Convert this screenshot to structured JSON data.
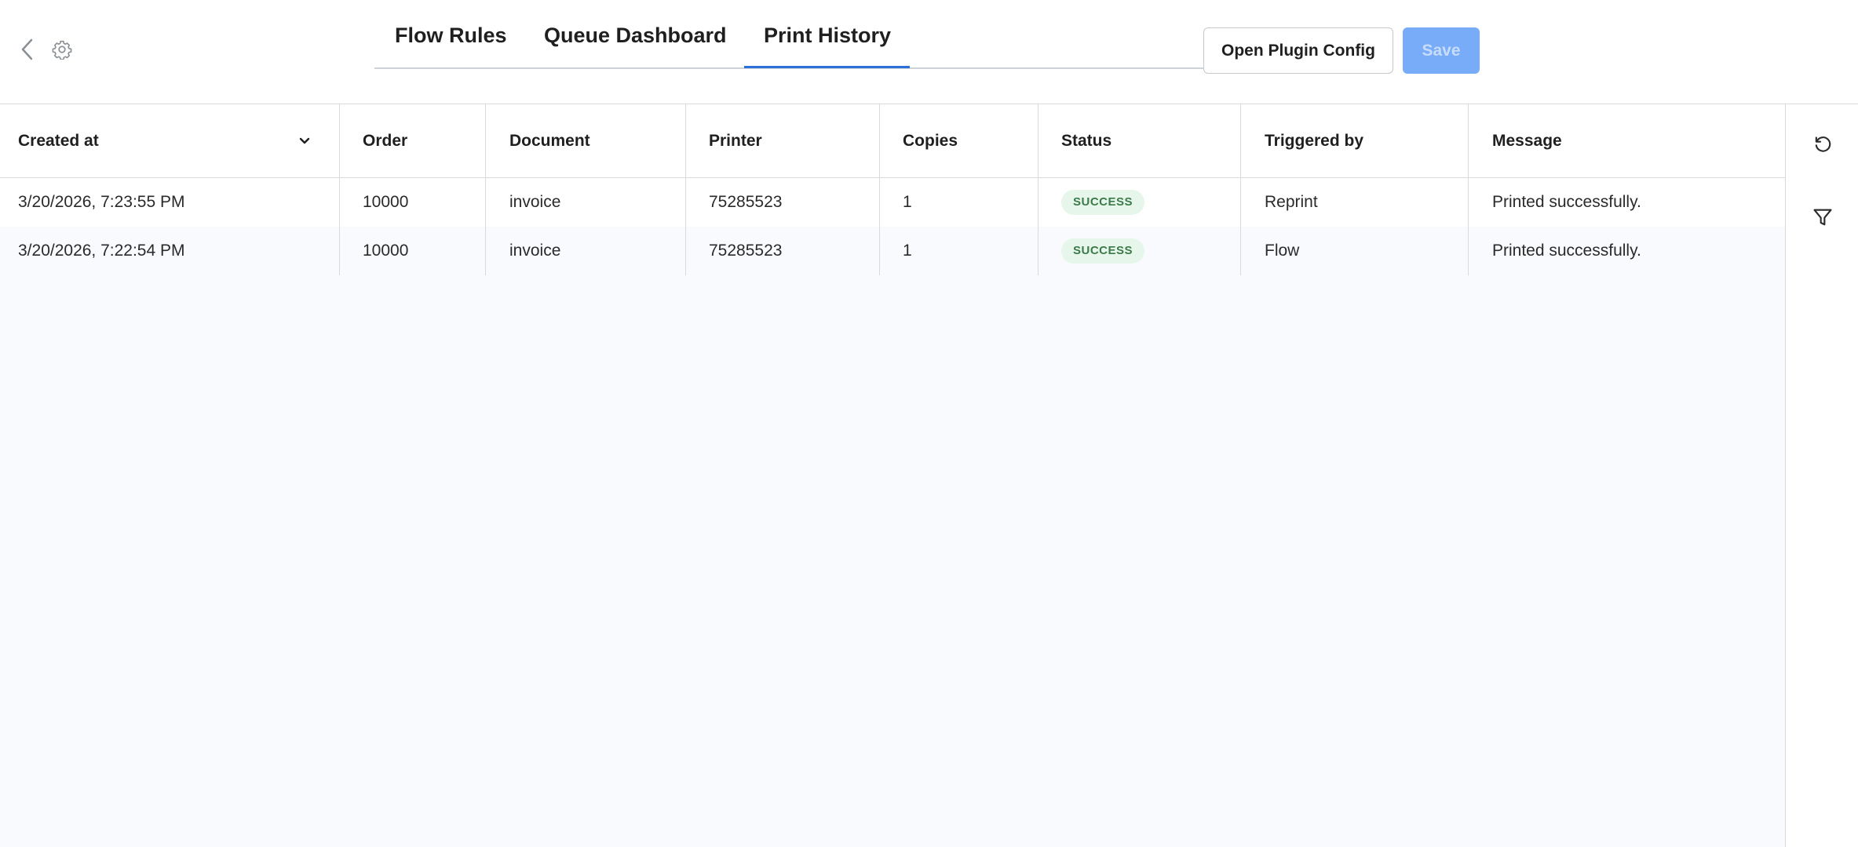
{
  "header": {
    "tabs": [
      {
        "label": "Flow Rules"
      },
      {
        "label": "Queue Dashboard"
      },
      {
        "label": "Print History"
      }
    ],
    "active_tab": "Print History",
    "open_config_label": "Open Plugin Config",
    "save_label": "Save",
    "icons": {
      "back": "chevron-left-icon",
      "settings": "gear-icon"
    }
  },
  "table": {
    "columns": [
      "Created at",
      "Order",
      "Document",
      "Printer",
      "Copies",
      "Status",
      "Triggered by",
      "Message"
    ],
    "sort_column": "Created at",
    "sort_direction": "desc",
    "rows": [
      {
        "created_at": "3/20/2026, 7:23:55 PM",
        "order": "10000",
        "document": "invoice",
        "printer": "75285523",
        "copies": "1",
        "status": "SUCCESS",
        "triggered_by": "Reprint",
        "message": "Printed successfully."
      },
      {
        "created_at": "3/20/2026, 7:22:54 PM",
        "order": "10000",
        "document": "invoice",
        "printer": "75285523",
        "copies": "1",
        "status": "SUCCESS",
        "triggered_by": "Flow",
        "message": "Printed successfully."
      }
    ]
  },
  "rail": {
    "icons": [
      "refresh-icon",
      "filter-icon"
    ]
  },
  "colors": {
    "accent": "#2b6fdb",
    "save_disabled_bg": "#78acf8",
    "success_bg": "#e6f6ea",
    "success_text": "#3b7a4a",
    "page_bg": "#f8fafd"
  }
}
